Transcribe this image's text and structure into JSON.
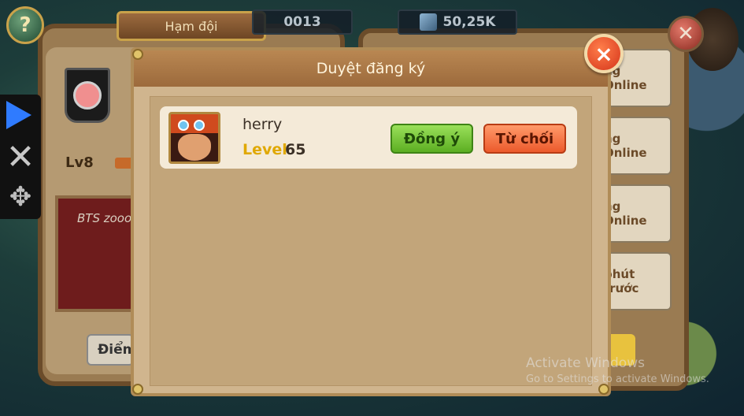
{
  "hud": {
    "help_label": "?",
    "top_number": "0013",
    "gold": "50,25K"
  },
  "back_panel": {
    "tab_title": "Hạm đội",
    "level": "Lv8",
    "motto": "BTS zooo",
    "points_label": "Điểm"
  },
  "right_list": {
    "items": [
      "ng Online",
      "ng Online",
      "ng Online",
      "phút trước"
    ]
  },
  "toolbar": {
    "play_icon": "play-icon",
    "close_icon": "close-icon",
    "move_icon": "move-icon"
  },
  "dialog": {
    "title": "Duyệt đăng ký",
    "close_label": "×",
    "requests": [
      {
        "name": "herry",
        "level_label": "Level",
        "level": "65",
        "accept_label": "Đồng ý",
        "reject_label": "Từ chối"
      }
    ]
  },
  "watermark": {
    "line1": "Activate Windows",
    "line2": "Go to Settings to activate Windows."
  },
  "colors": {
    "accept": "#5cae22",
    "reject": "#ec5a2c",
    "dialog_bg": "#d0b58e",
    "header": "#9c6a3c"
  }
}
